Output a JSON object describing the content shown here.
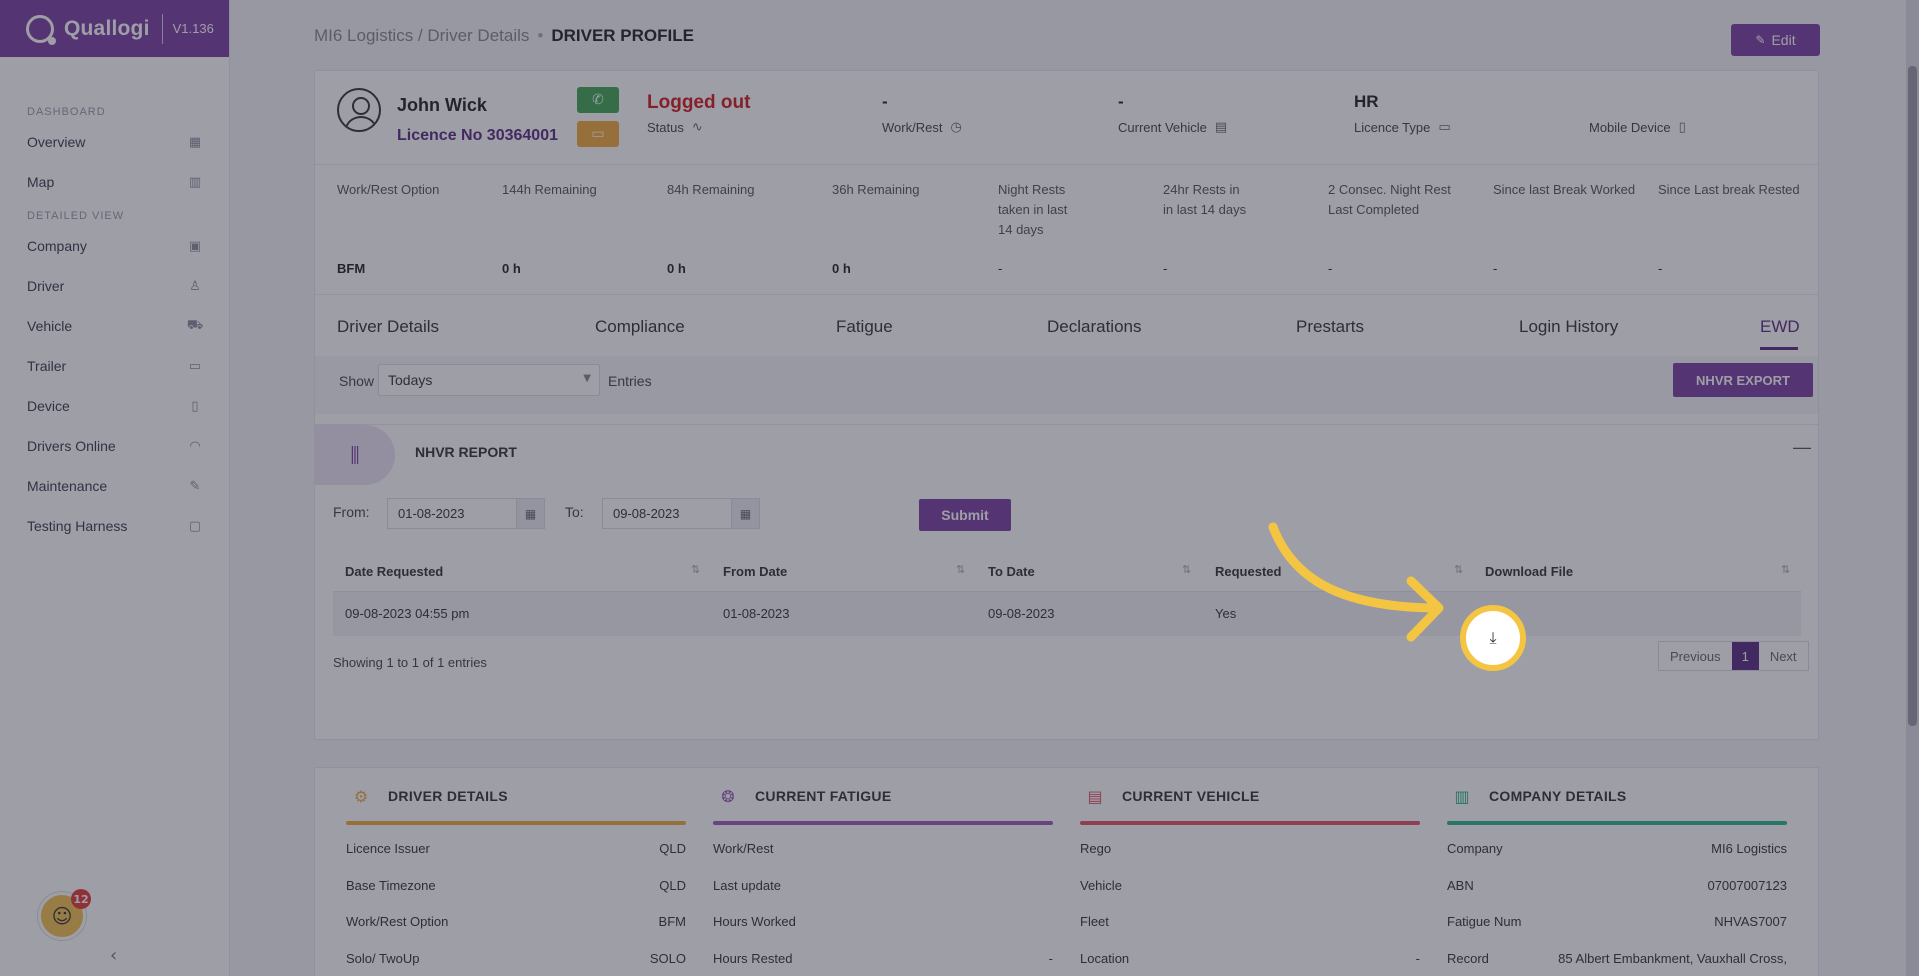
{
  "brand": {
    "name": "Quallogi",
    "version": "V1.136"
  },
  "sidebar": {
    "sections": [
      {
        "label": "DASHBOARD"
      },
      {
        "label": "DETAILED VIEW"
      }
    ],
    "items": [
      {
        "label": "Overview",
        "icon": "grid-icon"
      },
      {
        "label": "Map",
        "icon": "map-icon"
      },
      {
        "label": "Company",
        "icon": "building-icon"
      },
      {
        "label": "Driver",
        "icon": "person-icon"
      },
      {
        "label": "Vehicle",
        "icon": "truck-icon"
      },
      {
        "label": "Trailer",
        "icon": "trailer-icon"
      },
      {
        "label": "Device",
        "icon": "phone-icon"
      },
      {
        "label": "Drivers Online",
        "icon": "wifi-icon"
      },
      {
        "label": "Maintenance",
        "icon": "wrench-icon"
      },
      {
        "label": "Testing Harness",
        "icon": "monitor-icon"
      }
    ],
    "notification_count": "12"
  },
  "breadcrumb": {
    "path": "MI6 Logistics / Driver Details",
    "current": "DRIVER PROFILE"
  },
  "header": {
    "edit_label": "Edit"
  },
  "driver": {
    "name": "John Wick",
    "licence": "Licence No 30364001",
    "status_value": "Logged out",
    "status_label": "Status",
    "workrest_value": "-",
    "workrest_label": "Work/Rest",
    "vehicle_value": "-",
    "vehicle_label": "Current Vehicle",
    "licence_type_value": "HR",
    "licence_type_label": "Licence Type",
    "mobile_label": "Mobile Device"
  },
  "fatigue": {
    "columns": [
      {
        "label": "Work/Rest Option",
        "value": "BFM"
      },
      {
        "label": "144h Remaining",
        "value": "0 h"
      },
      {
        "label": "84h Remaining",
        "value": "0 h"
      },
      {
        "label": "36h Remaining",
        "value": "0 h"
      },
      {
        "label": "Night Rests\ntaken in last\n14 days",
        "value": "-"
      },
      {
        "label": "24hr Rests in\nin last 14 days",
        "value": "-"
      },
      {
        "label": "2 Consec. Night Rest\nLast Completed",
        "value": "-"
      },
      {
        "label": "Since last Break Worked",
        "value": "-"
      },
      {
        "label": "Since Last break Rested",
        "value": "-"
      }
    ]
  },
  "tabs": [
    "Driver Details",
    "Compliance",
    "Fatigue",
    "Declarations",
    "Prestarts",
    "Login History",
    "EWD"
  ],
  "active_tab": "EWD",
  "entries": {
    "show_label": "Show",
    "selected": "Todays",
    "entries_label": "Entries",
    "export_label": "NHVR EXPORT"
  },
  "report": {
    "title": "NHVR REPORT",
    "from_label": "From:",
    "from_value": "01-08-2023",
    "to_label": "To:",
    "to_value": "09-08-2023",
    "submit_label": "Submit",
    "columns": [
      "Date Requested",
      "From Date",
      "To Date",
      "Requested",
      "Download File"
    ],
    "rows": [
      {
        "date_requested": "09-08-2023 04:55 pm",
        "from_date": "01-08-2023",
        "to_date": "09-08-2023",
        "requested": "Yes"
      }
    ],
    "showing": "Showing 1 to 1 of 1 entries",
    "pager": {
      "prev": "Previous",
      "page": "1",
      "next": "Next"
    }
  },
  "panels": {
    "driver_details": {
      "title": "DRIVER DETAILS",
      "color": "#f2a93b",
      "rows": [
        {
          "k": "Licence Issuer",
          "v": "QLD"
        },
        {
          "k": "Base Timezone",
          "v": "QLD"
        },
        {
          "k": "Work/Rest Option",
          "v": "BFM"
        },
        {
          "k": "Solo/ TwoUp",
          "v": "SOLO"
        }
      ]
    },
    "current_fatigue": {
      "title": "CURRENT FATIGUE",
      "color": "#9b59b6",
      "rows": [
        {
          "k": "Work/Rest",
          "v": ""
        },
        {
          "k": "Last update",
          "v": ""
        },
        {
          "k": "Hours Worked",
          "v": ""
        },
        {
          "k": "Hours Rested",
          "v": "-"
        }
      ]
    },
    "current_vehicle": {
      "title": "CURRENT VEHICLE",
      "color": "#e05563",
      "rows": [
        {
          "k": "Rego",
          "v": ""
        },
        {
          "k": "Vehicle",
          "v": ""
        },
        {
          "k": "Fleet",
          "v": ""
        },
        {
          "k": "Location",
          "v": "-"
        }
      ]
    },
    "company_details": {
      "title": "COMPANY DETAILS",
      "color": "#2bb58a",
      "rows": [
        {
          "k": "Company",
          "v": "MI6 Logistics"
        },
        {
          "k": "ABN",
          "v": "07007007123"
        },
        {
          "k": "Fatigue Num",
          "v": "NHVAS7007"
        },
        {
          "k": "Record",
          "v": "85 Albert Embankment, Vauxhall Cross,"
        }
      ]
    }
  },
  "colors": {
    "brand": "#7b3fa0",
    "accent": "#5a2a80",
    "highlight": "#f4c542",
    "logged_out": "#d11a1a"
  }
}
